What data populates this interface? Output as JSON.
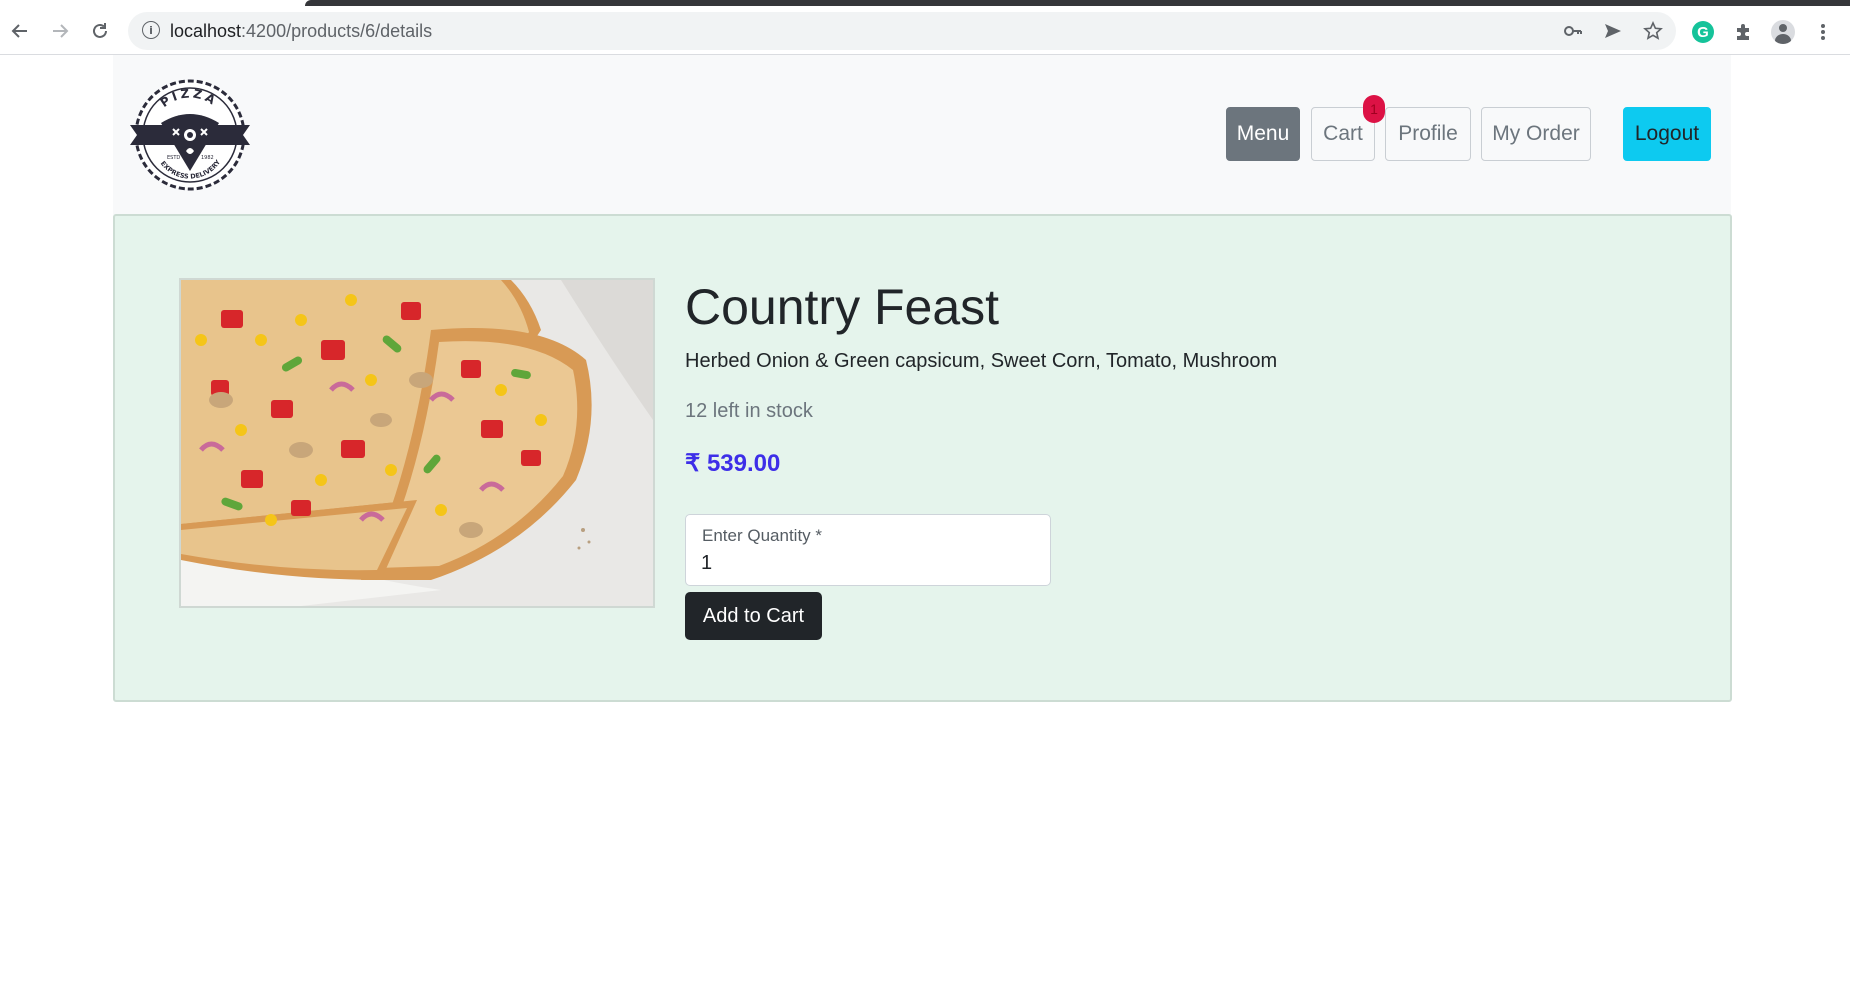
{
  "browser": {
    "url_host": "localhost",
    "url_path": ":4200/products/6/details"
  },
  "nav": {
    "menu_label": "Menu",
    "cart_label": "Cart",
    "cart_count": "1",
    "profile_label": "Profile",
    "orders_label": "My Order",
    "logout_label": "Logout"
  },
  "logo": {
    "top_text": "PIZZA",
    "bottom_text": "EXPRESS DELIVERY",
    "est_left": "ESTD",
    "est_right": "1982"
  },
  "product": {
    "title": "Country Feast",
    "description": "Herbed Onion & Green capsicum, Sweet Corn, Tomato, Mushroom",
    "stock": "12 left in stock",
    "price": "₹ 539.00",
    "quantity_label": "Enter Quantity *",
    "quantity_value": "1",
    "add_to_cart_label": "Add to Cart"
  },
  "colors": {
    "active_nav": "#6c757d",
    "logout": "#0dcaf0",
    "badge": "#dc1245",
    "price": "#3d2ee8",
    "card_bg": "#e5f4ec"
  }
}
